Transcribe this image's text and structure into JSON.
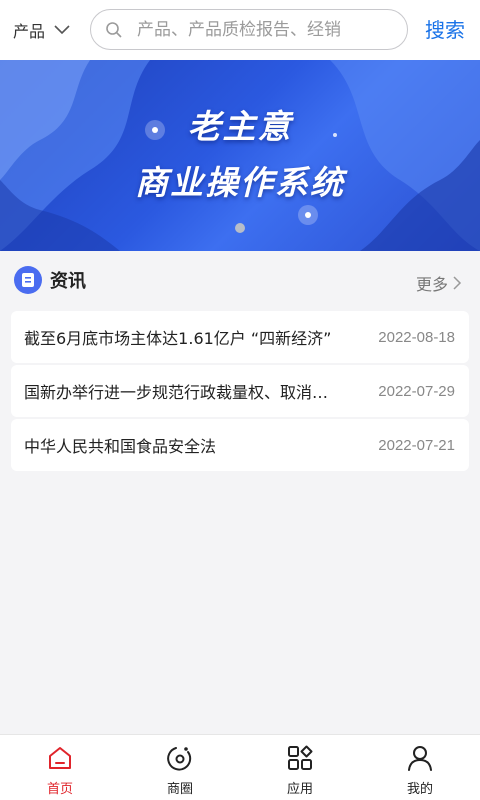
{
  "header": {
    "category_label": "产品",
    "search_placeholder": "产品、产品质检报告、经销",
    "search_button": "搜索"
  },
  "banner": {
    "line1": "老主意",
    "line2": "商业操作系统"
  },
  "news": {
    "title": "资讯",
    "more": "更多",
    "items": [
      {
        "title": "截至6月底市场主体达1.61亿户 “四新经济”",
        "date": "2022-08-18"
      },
      {
        "title": "国新办举行进一步规范行政裁量权、取消罚款事项",
        "date": "2022-07-29"
      },
      {
        "title": "中华人民共和国食品安全法",
        "date": "2022-07-21"
      }
    ]
  },
  "tabbar": {
    "tabs": [
      {
        "label": "首页",
        "icon": "home-icon",
        "active": true
      },
      {
        "label": "商圈",
        "icon": "orbit-icon",
        "active": false
      },
      {
        "label": "应用",
        "icon": "apps-icon",
        "active": false
      },
      {
        "label": "我的",
        "icon": "user-icon",
        "active": false
      }
    ]
  },
  "colors": {
    "accent": "#1a73e8",
    "active_tab": "#e0242b",
    "banner": "#2b59e0"
  }
}
